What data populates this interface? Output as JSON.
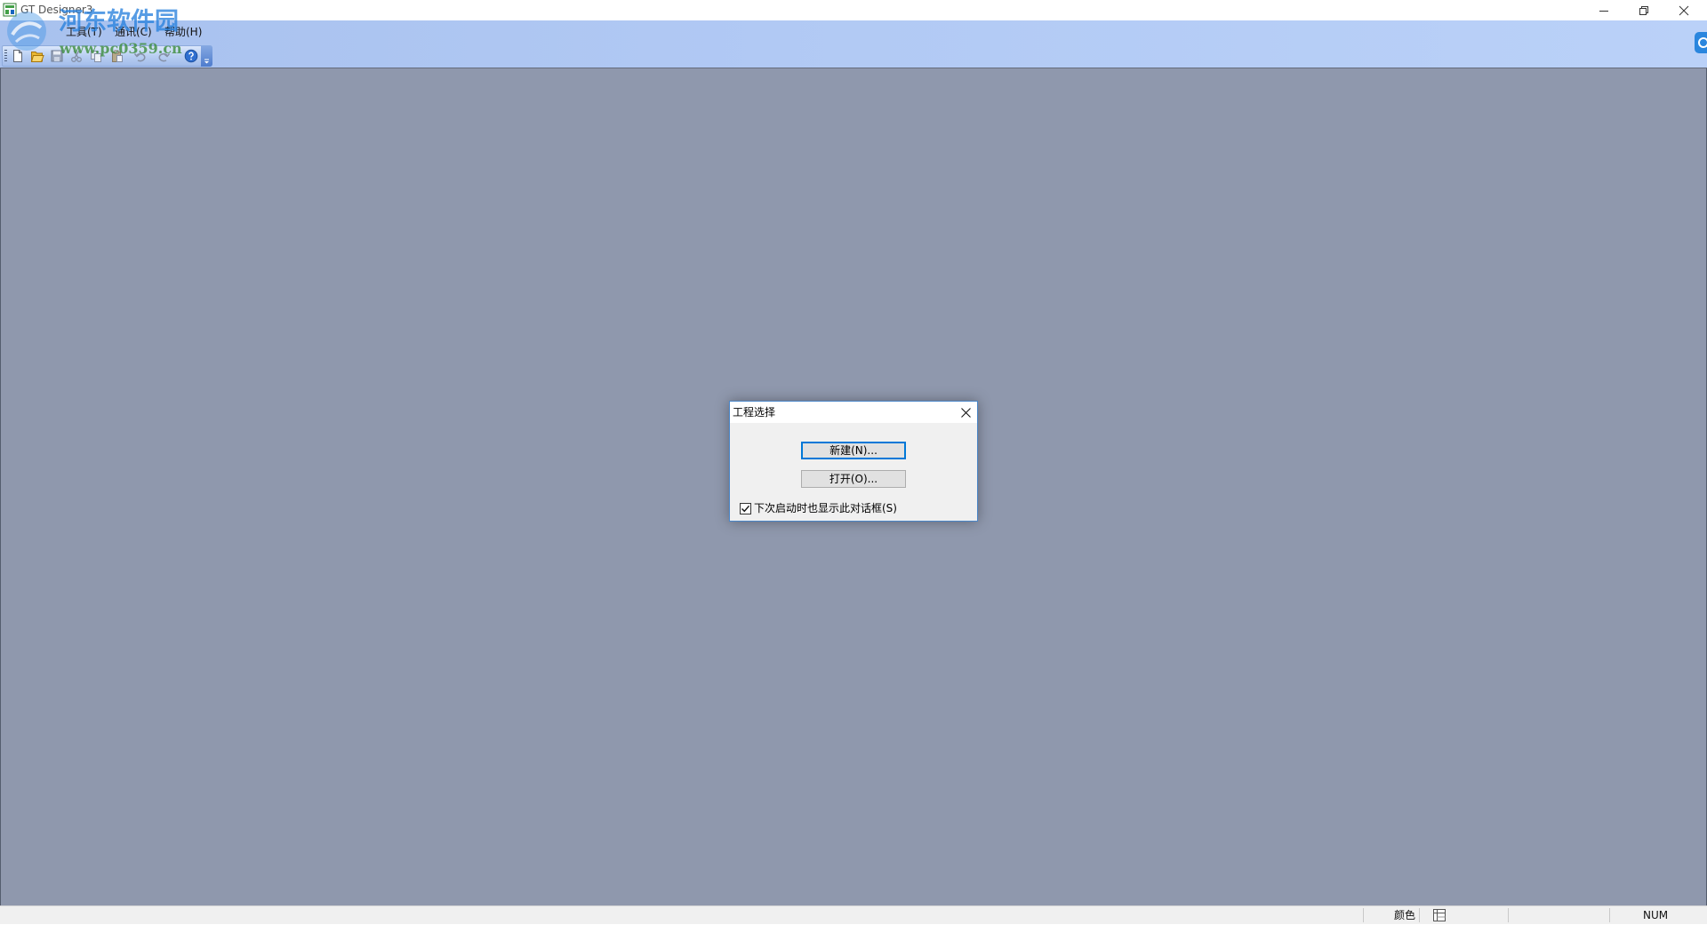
{
  "window": {
    "title": "GT Designer3",
    "controls": [
      "minimize-icon",
      "restore-icon",
      "close-icon"
    ]
  },
  "menu": {
    "items": [
      {
        "label": "工具(T)"
      },
      {
        "label": "通讯(C)"
      },
      {
        "label": "帮助(H)"
      }
    ]
  },
  "toolbar": {
    "icons": [
      "new-project-icon",
      "open-project-icon",
      "save-icon",
      "cut-icon",
      "copy-icon",
      "paste-icon",
      "undo-icon",
      "redo-icon",
      "help-icon"
    ]
  },
  "watermark": {
    "site_name": "河东软件园",
    "url": "www.pc0359.cn"
  },
  "dialog": {
    "title": "工程选择",
    "new_button": "新建(N)...",
    "open_button": "打开(O)...",
    "show_on_startup": {
      "label": "下次启动时也显示此对话框(S)",
      "checked": true
    }
  },
  "statusbar": {
    "color_label": "颜色",
    "num_indicator": "NUM"
  },
  "colors": {
    "workspace": "#8f98ad",
    "menubar": "#b1c9f4",
    "dialog_border": "#4a86c8",
    "default_button_border": "#0078d7",
    "help_icon": "#2f6fd0"
  }
}
